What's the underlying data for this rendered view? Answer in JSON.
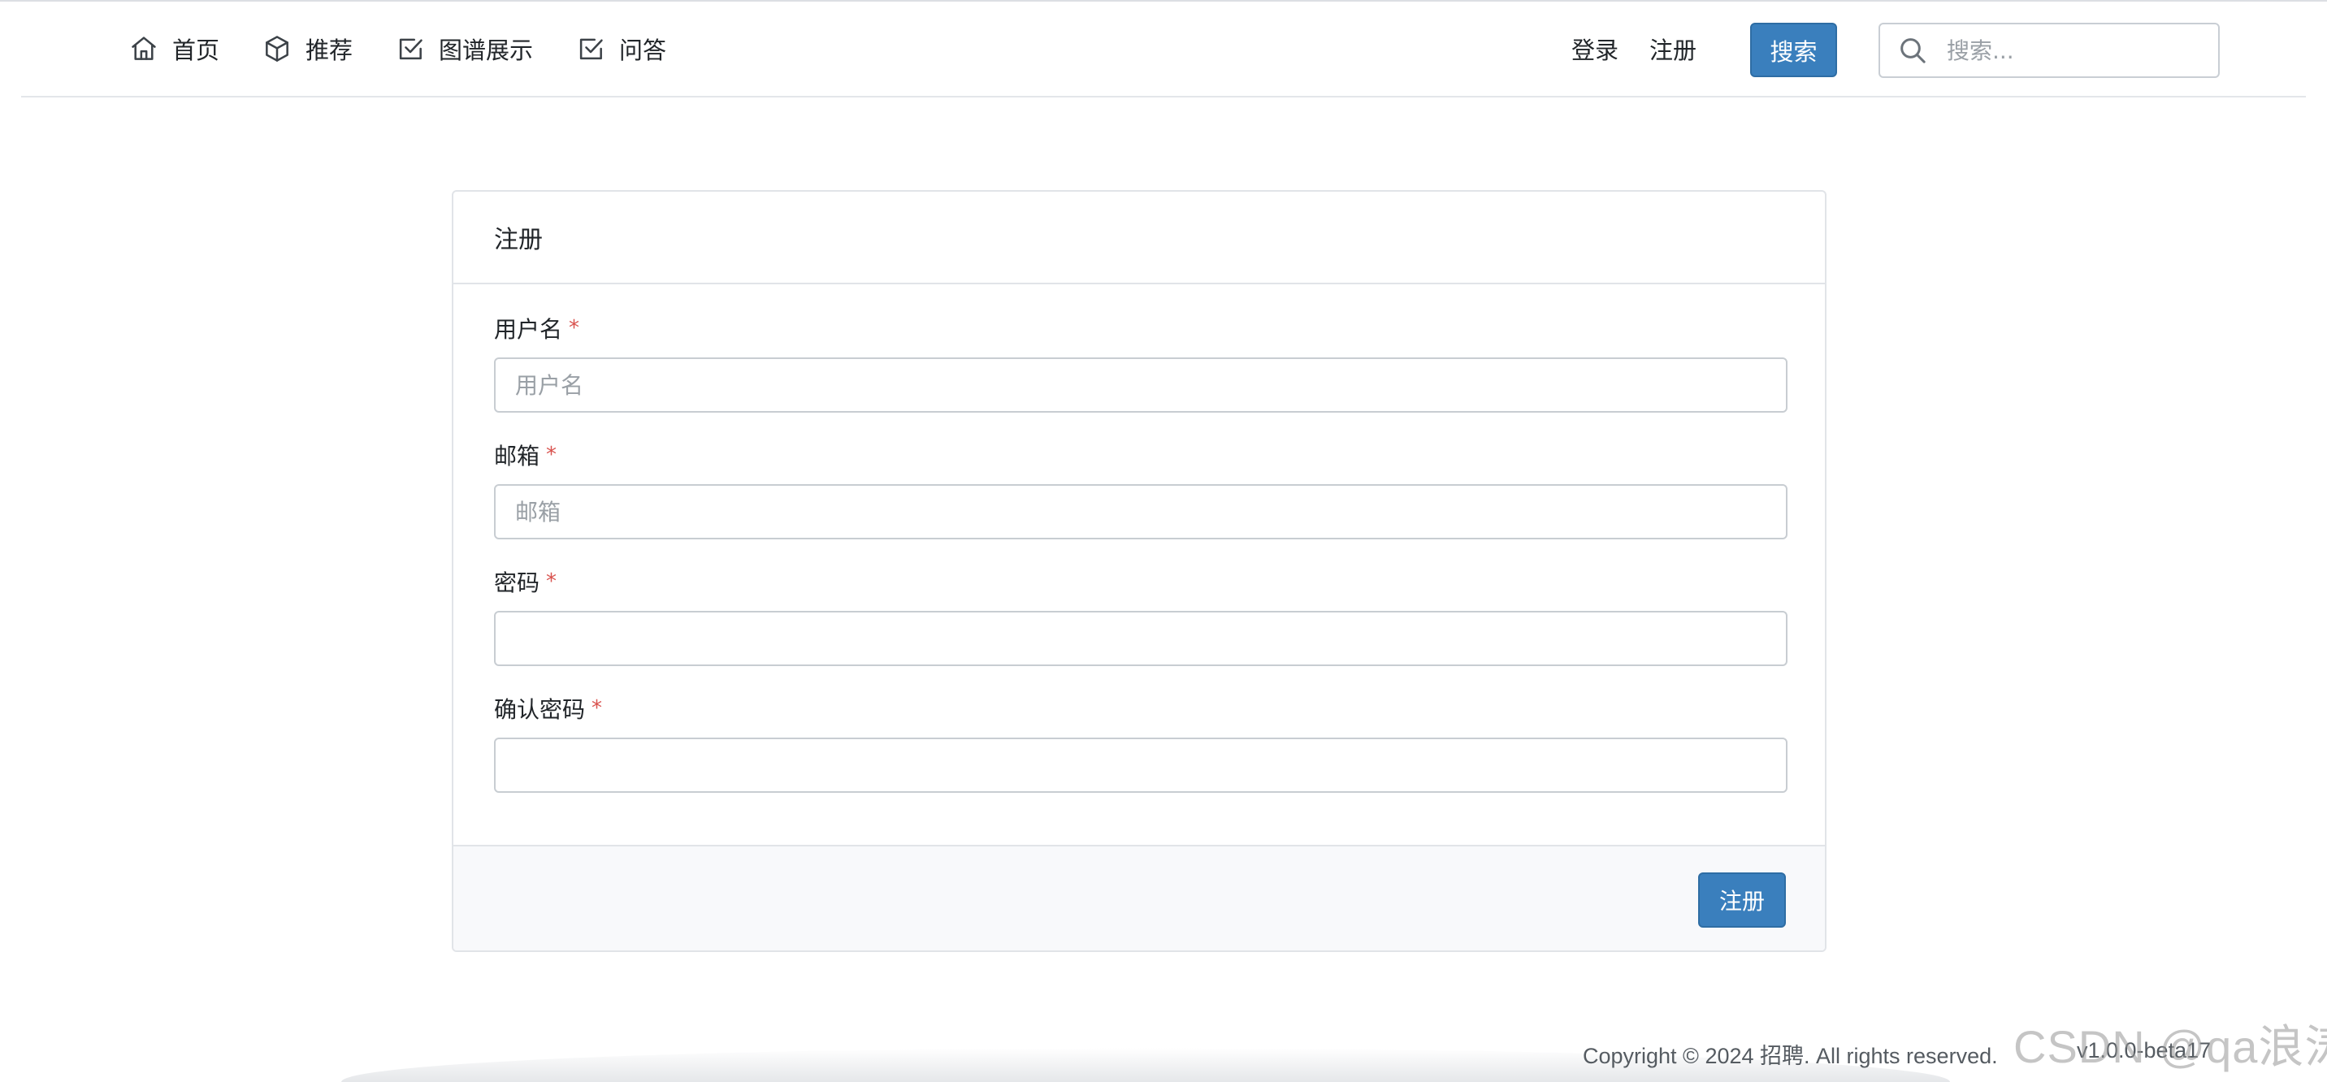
{
  "navbar": {
    "items": [
      {
        "label": "首页",
        "icon": "home-icon"
      },
      {
        "label": "推荐",
        "icon": "cube-icon"
      },
      {
        "label": "图谱展示",
        "icon": "checkbox-icon"
      },
      {
        "label": "问答",
        "icon": "checkbox-icon"
      }
    ],
    "login_label": "登录",
    "register_label": "注册",
    "search_button_label": "搜索",
    "search_placeholder": "搜索...",
    "search_value": ""
  },
  "form": {
    "title": "注册",
    "required_mark": "*",
    "fields": [
      {
        "label": "用户名",
        "placeholder": "用户名",
        "value": ""
      },
      {
        "label": "邮箱",
        "placeholder": "邮箱",
        "value": ""
      },
      {
        "label": "密码",
        "placeholder": "",
        "value": ""
      },
      {
        "label": "确认密码",
        "placeholder": "",
        "value": ""
      }
    ],
    "submit_label": "注册"
  },
  "footer": {
    "copyright": "Copyright © 2024 招聘. All rights reserved.",
    "version": "v1.0.0-beta17"
  },
  "watermark": "CSDN @qa浪涛",
  "colors": {
    "primary": "#3a7fbd",
    "required": "#d9534f",
    "border": "#c8cdd2",
    "footer_bg": "#f8f9fb"
  }
}
